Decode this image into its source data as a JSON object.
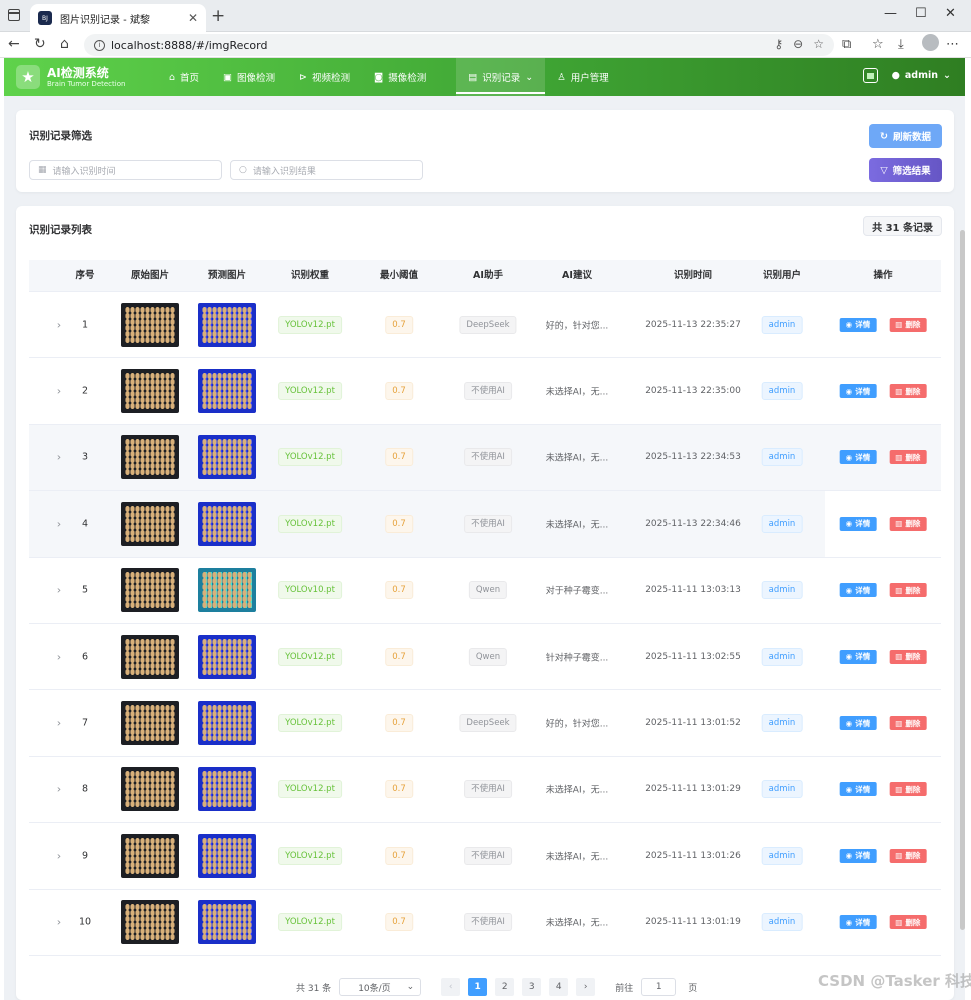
{
  "browser": {
    "tab_title": "图片识别记录 - 斌黎",
    "favicon_text": "BJ",
    "url": "localhost:8888/#/imgRecord"
  },
  "app": {
    "title": "AI检测系统",
    "subtitle": "Brain Tumor Detection",
    "user": "admin",
    "menu": [
      {
        "label": "首页",
        "icon": "home-icon"
      },
      {
        "label": "图像检测",
        "icon": "image-icon"
      },
      {
        "label": "视频检测",
        "icon": "play-icon"
      },
      {
        "label": "摄像检测",
        "icon": "camera-icon"
      },
      {
        "label": "识别记录",
        "icon": "document-icon",
        "active": true
      },
      {
        "label": "用户管理",
        "icon": "user-icon"
      }
    ]
  },
  "filter": {
    "title": "识别记录筛选",
    "time_placeholder": "请输入识别时间",
    "result_placeholder": "请输入识别结果",
    "refresh_label": "刷新数据",
    "filter_label": "筛选结果"
  },
  "list": {
    "title": "识别记录列表",
    "count_label": "共 31 条记录",
    "columns": [
      "序号",
      "原始图片",
      "预测图片",
      "识别权重",
      "最小阈值",
      "AI助手",
      "AI建议",
      "识别时间",
      "识别用户",
      "操作"
    ],
    "detail_label": "详情",
    "delete_label": "删除",
    "rows": [
      {
        "index": "1",
        "weight": "YOLOv12.pt",
        "threshold": "0.7",
        "ai": "DeepSeek",
        "advice": "好的，针对您...",
        "time": "2025-11-13 22:35:27",
        "user": "admin"
      },
      {
        "index": "2",
        "weight": "YOLOv12.pt",
        "threshold": "0.7",
        "ai": "不使用AI",
        "advice": "未选择AI，无...",
        "time": "2025-11-13 22:35:00",
        "user": "admin"
      },
      {
        "index": "3",
        "weight": "YOLOv12.pt",
        "threshold": "0.7",
        "ai": "不使用AI",
        "advice": "未选择AI，无...",
        "time": "2025-11-13 22:34:53",
        "user": "admin"
      },
      {
        "index": "4",
        "weight": "YOLOv12.pt",
        "threshold": "0.7",
        "ai": "不使用AI",
        "advice": "未选择AI，无...",
        "time": "2025-11-13 22:34:46",
        "user": "admin"
      },
      {
        "index": "5",
        "weight": "YOLOv10.pt",
        "threshold": "0.7",
        "ai": "Qwen",
        "advice": "对于种子霉变...",
        "time": "2025-11-11 13:03:13",
        "user": "admin"
      },
      {
        "index": "6",
        "weight": "YOLOv12.pt",
        "threshold": "0.7",
        "ai": "Qwen",
        "advice": "针对种子霉变...",
        "time": "2025-11-11 13:02:55",
        "user": "admin"
      },
      {
        "index": "7",
        "weight": "YOLOv12.pt",
        "threshold": "0.7",
        "ai": "DeepSeek",
        "advice": "好的，针对您...",
        "time": "2025-11-11 13:01:52",
        "user": "admin"
      },
      {
        "index": "8",
        "weight": "YOLOv12.pt",
        "threshold": "0.7",
        "ai": "不使用AI",
        "advice": "未选择AI，无...",
        "time": "2025-11-11 13:01:29",
        "user": "admin"
      },
      {
        "index": "9",
        "weight": "YOLOv12.pt",
        "threshold": "0.7",
        "ai": "不使用AI",
        "advice": "未选择AI，无...",
        "time": "2025-11-11 13:01:26",
        "user": "admin"
      },
      {
        "index": "10",
        "weight": "YOLOv12.pt",
        "threshold": "0.7",
        "ai": "不使用AI",
        "advice": "未选择AI，无...",
        "time": "2025-11-11 13:01:19",
        "user": "admin"
      }
    ]
  },
  "pagination": {
    "total_label": "共 31 条",
    "page_size": "10条/页",
    "pages": [
      "1",
      "2",
      "3",
      "4"
    ],
    "current": "1",
    "goto_label": "前往",
    "goto_value": "1",
    "page_unit": "页"
  },
  "watermark": "CSDN @Tasker 科技"
}
